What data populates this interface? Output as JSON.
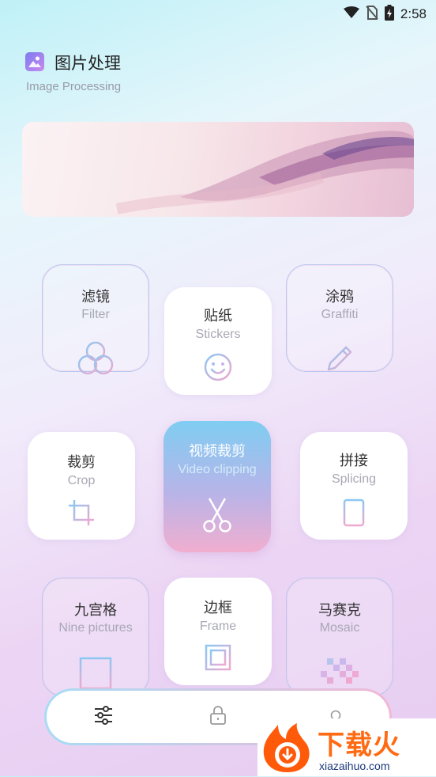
{
  "status_bar": {
    "time": "2:58",
    "icons": [
      "wifi-icon",
      "no-sim-icon",
      "battery-charging-icon"
    ]
  },
  "header": {
    "title": "图片处理",
    "subtitle": "Image Processing",
    "logo_icon": "image-icon"
  },
  "tiles": [
    {
      "title": "滤镜",
      "subtitle": "Filter",
      "icon": "filter-icon"
    },
    {
      "title": "贴纸",
      "subtitle": "Stickers",
      "icon": "smiley-icon"
    },
    {
      "title": "涂鸦",
      "subtitle": "Graffiti",
      "icon": "pencil-icon"
    },
    {
      "title": "裁剪",
      "subtitle": "Crop",
      "icon": "crop-icon"
    },
    {
      "title": "视频裁剪",
      "subtitle": "Video clipping",
      "icon": "scissors-icon"
    },
    {
      "title": "拼接",
      "subtitle": "Splicing",
      "icon": "splice-icon"
    },
    {
      "title": "九宫格",
      "subtitle": "Nine pictures",
      "icon": "grid-icon"
    },
    {
      "title": "边框",
      "subtitle": "Frame",
      "icon": "frame-icon"
    },
    {
      "title": "马赛克",
      "subtitle": "Mosaic",
      "icon": "mosaic-icon"
    }
  ],
  "tab_bar": {
    "items": [
      "sliders-icon",
      "lock-icon",
      "circle-icon"
    ]
  },
  "watermark": {
    "text": "下载火",
    "url": "xiazaihuo.com"
  },
  "colors": {
    "accent_blue": "#7fcdf2",
    "accent_pink": "#f1aecf",
    "icon_gradient_start": "#8cc8f2",
    "icon_gradient_end": "#f0a8cf"
  }
}
